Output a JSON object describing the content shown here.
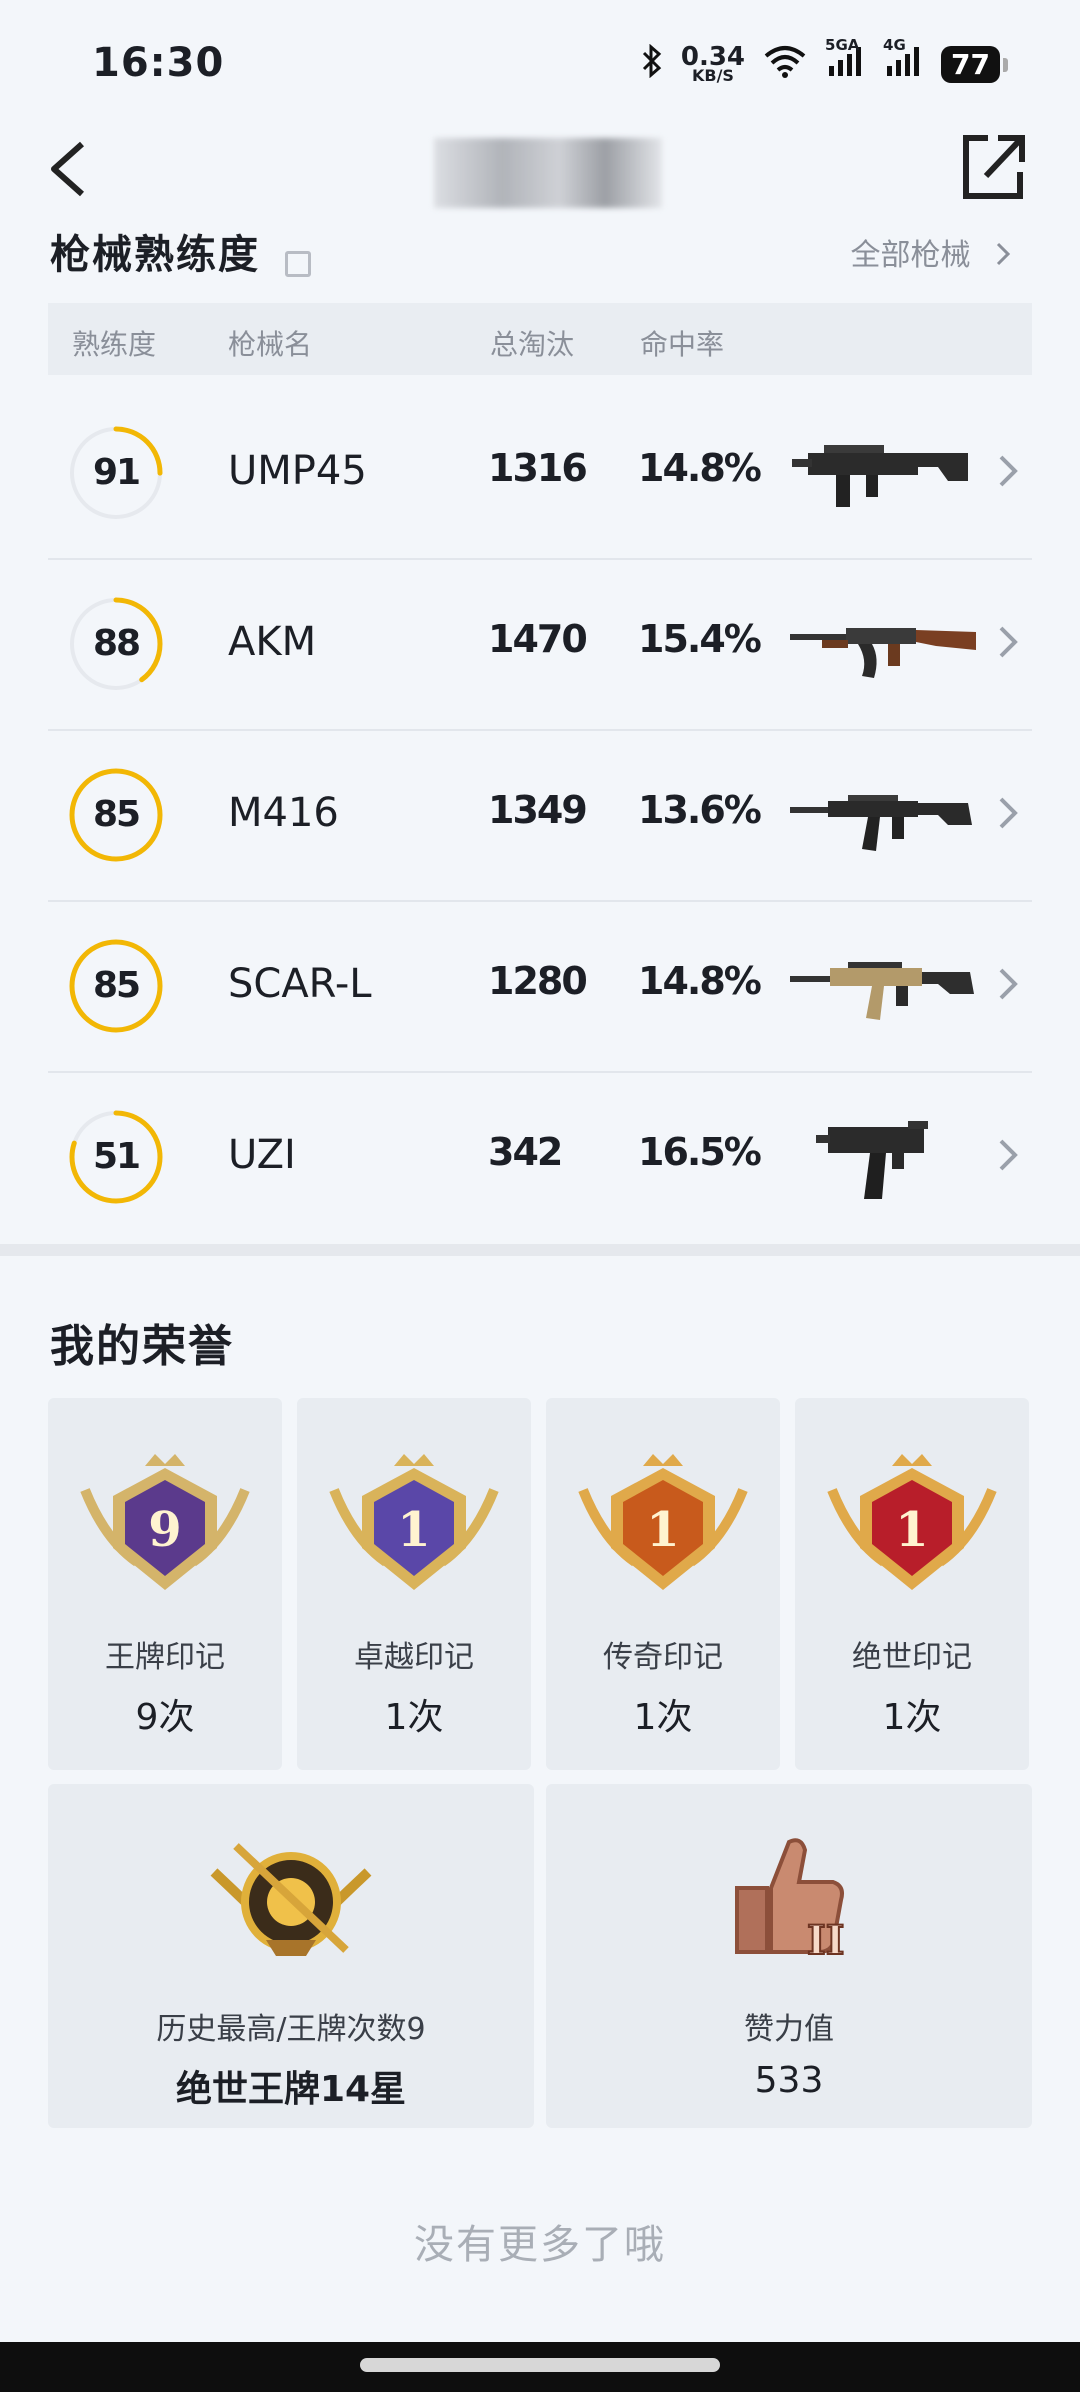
{
  "status": {
    "time": "16:30",
    "net_speed": "0.34",
    "net_unit": "KB/S",
    "signal1": "5GA",
    "signal2": "4G",
    "battery": "77"
  },
  "weapon_section": {
    "title": "枪械熟练度",
    "more": "全部枪械",
    "headers": {
      "mastery": "熟练度",
      "name": "枪械名",
      "kills": "总淘汰",
      "accuracy": "命中率"
    },
    "rows": [
      {
        "mastery": "91",
        "name": "UMP45",
        "kills": "1316",
        "accuracy": "14.8%",
        "icon": "smg-ump45-icon",
        "ring_color": "#f2b705",
        "progress": 0.25
      },
      {
        "mastery": "88",
        "name": "AKM",
        "kills": "1470",
        "accuracy": "15.4%",
        "icon": "rifle-akm-icon",
        "ring_color": "#f2b705",
        "progress": 0.4
      },
      {
        "mastery": "85",
        "name": "M416",
        "kills": "1349",
        "accuracy": "13.6%",
        "icon": "rifle-m416-icon",
        "ring_color": "#f2b705",
        "progress": 1.0
      },
      {
        "mastery": "85",
        "name": "SCAR-L",
        "kills": "1280",
        "accuracy": "14.8%",
        "icon": "rifle-scarl-icon",
        "ring_color": "#f2b705",
        "progress": 1.0
      },
      {
        "mastery": "51",
        "name": "UZI",
        "kills": "342",
        "accuracy": "16.5%",
        "icon": "smg-uzi-icon",
        "ring_color": "#f2b705",
        "progress": 0.8
      }
    ]
  },
  "honor": {
    "title": "我的荣誉",
    "badges": [
      {
        "label": "王牌印记",
        "value": "9次",
        "emblem_number": "9"
      },
      {
        "label": "卓越印记",
        "value": "1次",
        "emblem_number": "1"
      },
      {
        "label": "传奇印记",
        "value": "1次",
        "emblem_number": "1"
      },
      {
        "label": "绝世印记",
        "value": "1次",
        "emblem_number": "1"
      }
    ],
    "history": {
      "label": "历史最高/王牌次数9",
      "value": "绝世王牌14星"
    },
    "likes": {
      "label": "赞力值",
      "value": "533",
      "emblem_number": "II"
    }
  },
  "footer": {
    "no_more": "没有更多了哦"
  }
}
